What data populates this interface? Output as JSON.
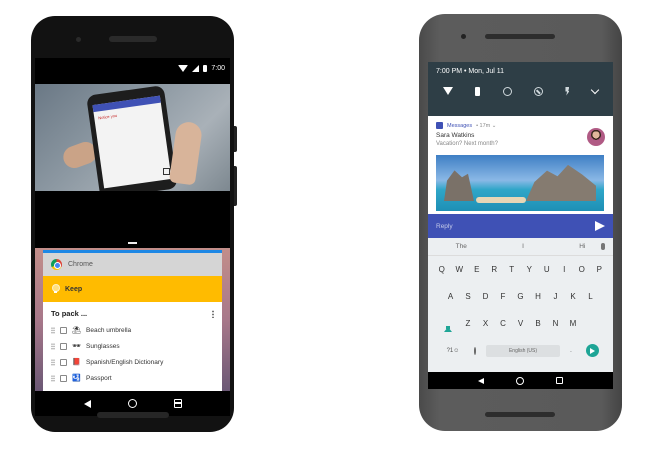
{
  "left_phone": {
    "status": {
      "time": "7:00"
    },
    "video": {
      "mini_screen_text": "Notice you"
    },
    "recents": {
      "chrome_card": {
        "title": "Chrome"
      },
      "keep_card": {
        "title": "Keep",
        "note_title": "To pack ...",
        "items": [
          {
            "emoji": "⛱",
            "label": "Beach umbrella"
          },
          {
            "emoji": "🕶",
            "label": "Sunglasses"
          },
          {
            "emoji": "📕",
            "label": "Spanish/English Dictionary"
          },
          {
            "emoji": "🛂",
            "label": "Passport"
          }
        ]
      }
    }
  },
  "right_phone": {
    "shade": {
      "time": "7:00 PM • Mon, Jul 11"
    },
    "notification": {
      "app": "Messages",
      "meta": "• 17m ⌄",
      "sender": "Sara Watkins",
      "text": "Vacation? Next month?",
      "reply_placeholder": "Reply"
    },
    "keyboard": {
      "suggestions": [
        "The",
        "I",
        "Hi"
      ],
      "row1": [
        "Q",
        "W",
        "E",
        "R",
        "T",
        "Y",
        "U",
        "I",
        "O",
        "P"
      ],
      "row2": [
        "A",
        "S",
        "D",
        "F",
        "G",
        "H",
        "J",
        "K",
        "L"
      ],
      "row3": [
        "Z",
        "X",
        "C",
        "V",
        "B",
        "N",
        "M"
      ],
      "symbols_label": "?1☺",
      "space_label": "English (US)"
    }
  },
  "colors": {
    "keep_yellow": "#ffbb00",
    "reply_blue": "#3f51b5",
    "keyboard_accent": "#1ea596"
  }
}
